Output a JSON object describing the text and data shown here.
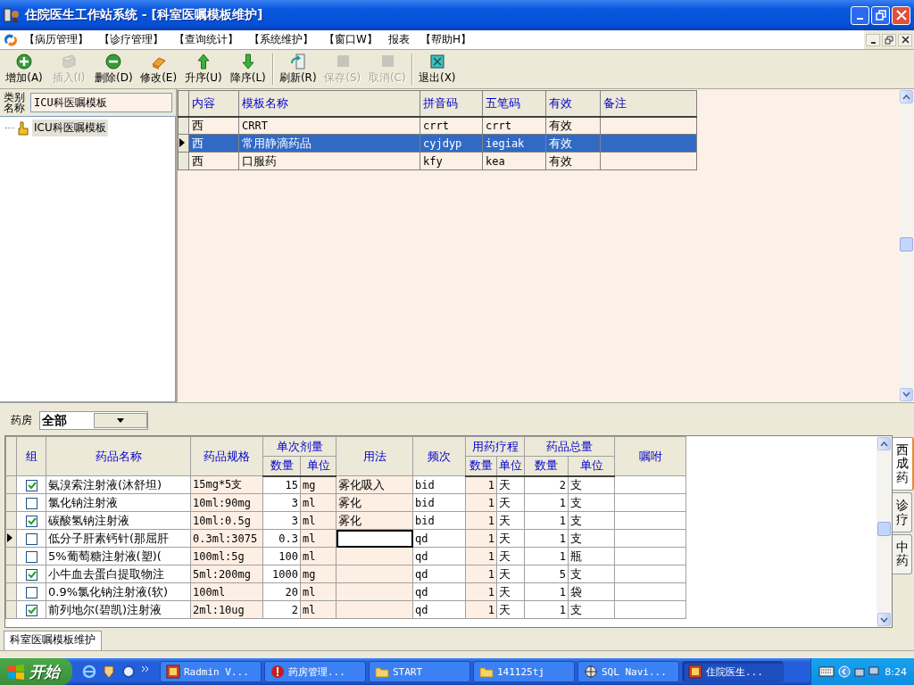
{
  "window": {
    "title": "住院医生工作站系统 - [科室医嘱模板维护]"
  },
  "menu": [
    "【病历管理】",
    "【诊疗管理】",
    "【查询统计】",
    "【系统维护】",
    "【窗口W】",
    "报表",
    "【帮助H】"
  ],
  "toolbar": [
    {
      "label": "增加(A)",
      "kind": "add",
      "disabled": false
    },
    {
      "label": "插入(I)",
      "kind": "insert",
      "disabled": true
    },
    {
      "label": "删除(D)",
      "kind": "delete",
      "disabled": false
    },
    {
      "label": "修改(E)",
      "kind": "edit",
      "disabled": false
    },
    {
      "label": "升序(U)",
      "kind": "up",
      "disabled": false
    },
    {
      "label": "降序(L)",
      "kind": "down",
      "disabled": false
    },
    {
      "label": "刷新(R)",
      "kind": "refresh",
      "disabled": false
    },
    {
      "label": "保存(S)",
      "kind": "save",
      "disabled": true
    },
    {
      "label": "取消(C)",
      "kind": "cancel",
      "disabled": true
    },
    {
      "label": "退出(X)",
      "kind": "exit",
      "disabled": false
    }
  ],
  "category": {
    "label": "类别名称",
    "value": "ICU科医嘱模板"
  },
  "tree": [
    {
      "label": "ICU科医嘱模板",
      "selected": true
    }
  ],
  "templates": {
    "columns": [
      "内容",
      "模板名称",
      "拼音码",
      "五笔码",
      "有效",
      "备注"
    ],
    "rows": [
      {
        "cells": [
          "西",
          "CRRT",
          "crrt",
          "crrt",
          "有效"
        ],
        "selected": false
      },
      {
        "cells": [
          "西",
          "常用静滴药品",
          "cyjdyp",
          "iegiak",
          "有效"
        ],
        "selected": true
      },
      {
        "cells": [
          "西",
          "口服药",
          "kfy",
          "kea",
          "有效"
        ],
        "selected": false
      }
    ]
  },
  "pharmacy": {
    "label": "药房",
    "value": "全部"
  },
  "drugs": {
    "columns": [
      {
        "label": "组"
      },
      {
        "label": "药品名称"
      },
      {
        "label": "药品规格"
      },
      {
        "label": "单次剂量",
        "sub": [
          "数量",
          "单位"
        ]
      },
      {
        "label": "用法"
      },
      {
        "label": "频次"
      },
      {
        "label": "用药疗程",
        "sub": [
          "数量",
          "单位"
        ]
      },
      {
        "label": "药品总量",
        "sub": [
          "数量",
          "单位"
        ]
      },
      {
        "label": "嘱咐"
      }
    ],
    "rows": [
      {
        "checked": true,
        "selected": false,
        "name": "氨溴索注射液(沐舒坦)",
        "spec": "15mg*5支",
        "dose": "15",
        "dose_unit": "mg",
        "usage": "雾化吸入",
        "freq": "bid",
        "days": "1",
        "days_unit": "天",
        "total": "2",
        "total_unit": "支"
      },
      {
        "checked": false,
        "selected": false,
        "name": "氯化钠注射液",
        "spec": "10ml:90mg",
        "dose": "3",
        "dose_unit": "ml",
        "usage": "雾化",
        "freq": "bid",
        "days": "1",
        "days_unit": "天",
        "total": "1",
        "total_unit": "支"
      },
      {
        "checked": true,
        "selected": false,
        "name": "碳酸氢钠注射液",
        "spec": "10ml:0.5g",
        "dose": "3",
        "dose_unit": "ml",
        "usage": "雾化",
        "freq": "bid",
        "days": "1",
        "days_unit": "天",
        "total": "1",
        "total_unit": "支"
      },
      {
        "checked": false,
        "selected": true,
        "name": "低分子肝素钙针(那屈肝",
        "spec": "0.3ml:3075",
        "dose": "0.3",
        "dose_unit": "ml",
        "freq": "qd",
        "days": "1",
        "days_unit": "天",
        "total": "1",
        "total_unit": "支"
      },
      {
        "checked": false,
        "selected": false,
        "name": "5%葡萄糖注射液(塑)(",
        "spec": "100ml:5g",
        "dose": "100",
        "dose_unit": "ml",
        "freq": "qd",
        "days": "1",
        "days_unit": "天",
        "total": "1",
        "total_unit": "瓶"
      },
      {
        "checked": true,
        "selected": false,
        "name": "小牛血去蛋白提取物注",
        "spec": "5ml:200mg",
        "dose": "1000",
        "dose_unit": "mg",
        "freq": "qd",
        "days": "1",
        "days_unit": "天",
        "total": "5",
        "total_unit": "支"
      },
      {
        "checked": false,
        "selected": false,
        "name": "0.9%氯化钠注射液(软)",
        "spec": "100ml",
        "dose": "20",
        "dose_unit": "ml",
        "freq": "qd",
        "days": "1",
        "days_unit": "天",
        "total": "1",
        "total_unit": "袋"
      },
      {
        "checked": true,
        "selected": false,
        "name": "前列地尔(碧凯)注射液",
        "spec": "2ml:10ug",
        "dose": "2",
        "dose_unit": "ml",
        "freq": "qd",
        "days": "1",
        "days_unit": "天",
        "total": "1",
        "total_unit": "支"
      }
    ]
  },
  "side_tabs": [
    {
      "label": "西成药",
      "selected": true
    },
    {
      "label": "诊疗",
      "selected": false
    },
    {
      "label": "中药",
      "selected": false
    }
  ],
  "window_tabs": [
    {
      "label": "科室医嘱模板维护",
      "selected": true
    }
  ],
  "taskbar": {
    "start": "开始",
    "tasks": [
      {
        "label": "Radmin V...",
        "kind": "app",
        "selected": false
      },
      {
        "label": "药房管理...",
        "kind": "alert",
        "selected": false
      },
      {
        "label": "START",
        "kind": "folder",
        "selected": false
      },
      {
        "label": "141125tj",
        "kind": "folder",
        "selected": false
      },
      {
        "label": "SQL Navi...",
        "kind": "compass",
        "selected": false
      },
      {
        "label": "住院医生...",
        "kind": "app",
        "selected": true
      }
    ],
    "clock": "8:24"
  }
}
